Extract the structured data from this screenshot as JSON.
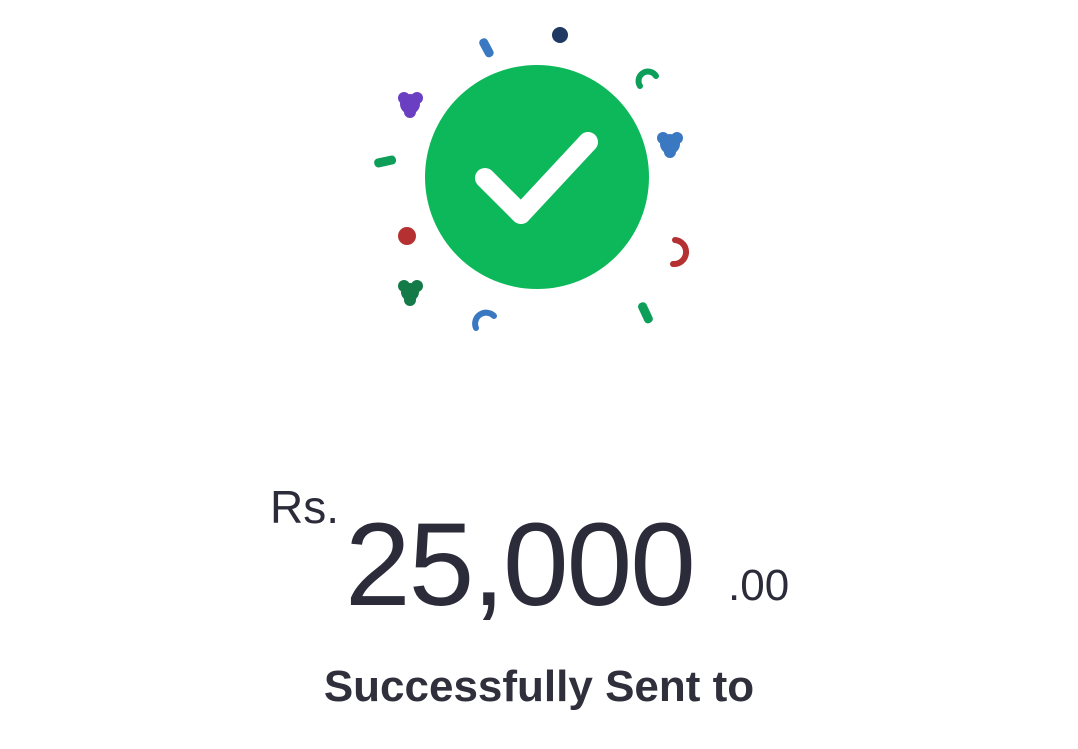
{
  "payment": {
    "currency": "Rs.",
    "amount_whole": "25,000",
    "amount_decimal": ".00",
    "status_text": "Successfully Sent to"
  },
  "colors": {
    "success_green": "#0cb85a",
    "check_mark": "#ffffff",
    "text_primary": "#2b2b3a"
  },
  "icons": {
    "success": "check-circle-icon",
    "decoration": "confetti"
  }
}
